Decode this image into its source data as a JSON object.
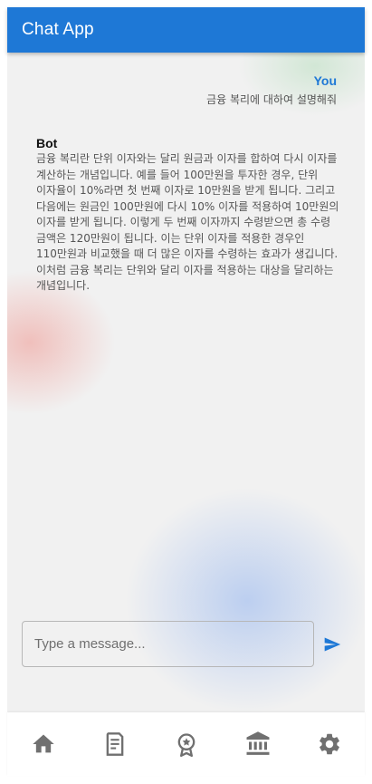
{
  "app": {
    "title": "Chat App",
    "accent_color": "#1e78d6"
  },
  "messages": [
    {
      "sender": "You",
      "text": "금융 복리에 대하여 설명해줘"
    },
    {
      "sender": "Bot",
      "text": "금융 복리란 단위 이자와는 달리 원금과 이자를 합하여 다시 이자를 계산하는 개념입니다. 예를 들어 100만원을 투자한 경우, 단위 이자율이 10%라면 첫 번째 이자로 10만원을 받게 됩니다. 그리고 다음에는 원금인 100만원에 다시 10% 이자를 적용하여 10만원의 이자를 받게 됩니다. 이렇게 두 번째 이자까지 수령받으면 총 수령 금액은 120만원이 됩니다. 이는 단위 이자를 적용한 경우인 110만원과 비교했을 때 더 많은 이자를 수령하는 효과가 생깁니다. 이처럼 금융 복리는 단위와 달리 이자를 적용하는 대상을 달리하는 개념입니다."
    }
  ],
  "composer": {
    "placeholder": "Type a message...",
    "value": "",
    "send_icon": "send-icon"
  },
  "bottom_nav": {
    "items": [
      {
        "icon": "home-icon"
      },
      {
        "icon": "receipt-icon"
      },
      {
        "icon": "award-icon"
      },
      {
        "icon": "bank-icon"
      },
      {
        "icon": "settings-icon"
      }
    ],
    "icon_color": "#707070"
  }
}
